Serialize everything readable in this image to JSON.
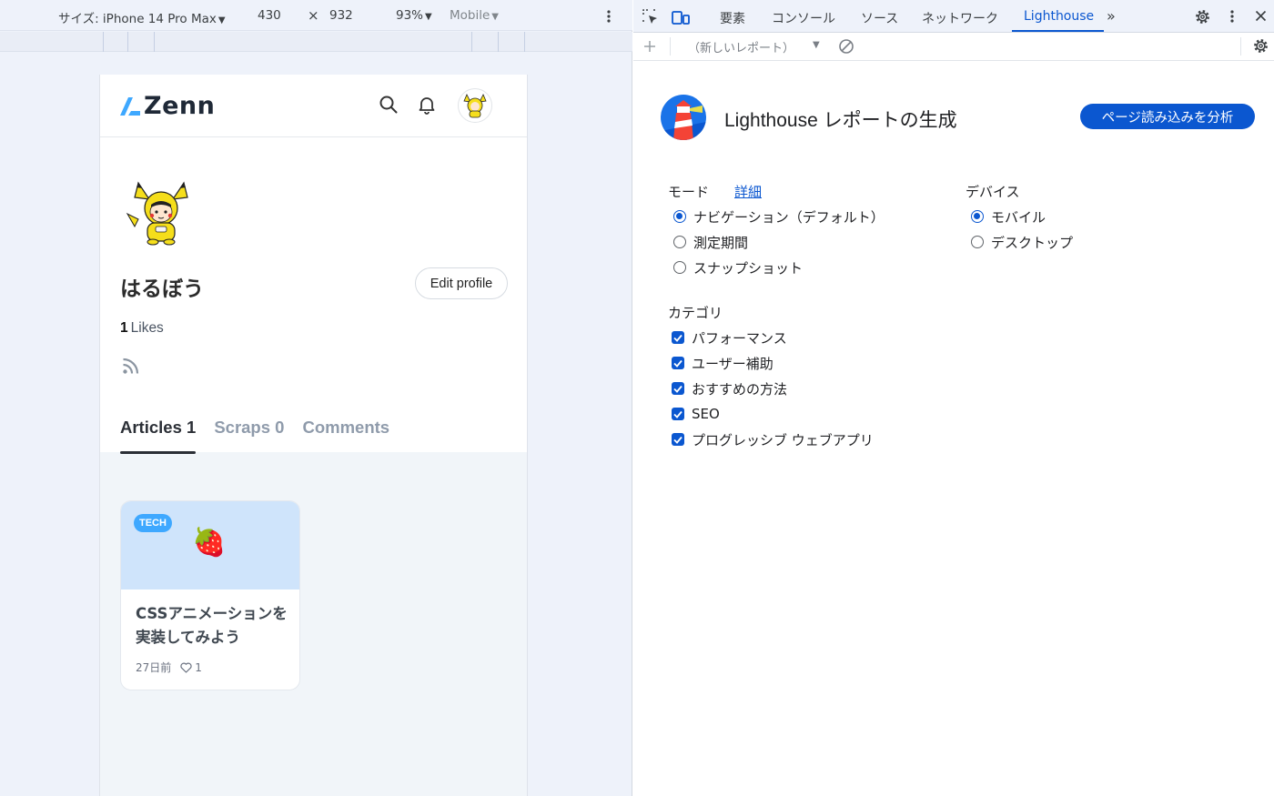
{
  "device_toolbar": {
    "size_label": "サイズ: iPhone 14 Pro Max",
    "width": "430",
    "times": "×",
    "height": "932",
    "zoom": "93%",
    "mode": "Mobile"
  },
  "zenn": {
    "logo_text": "Zenn",
    "profile_name": "はるぼう",
    "edit_profile_label": "Edit profile",
    "likes_count": "1",
    "likes_label": "Likes",
    "tabs": [
      {
        "label": "Articles",
        "count": "1"
      },
      {
        "label": "Scraps",
        "count": "0"
      },
      {
        "label": "Comments",
        "count": ""
      }
    ],
    "article_card": {
      "badge": "TECH",
      "emoji": "🍓",
      "title": "CSSアニメーションを実装してみよう",
      "date": "27日前",
      "likes": "1"
    }
  },
  "devtools": {
    "tabs": [
      "要素",
      "コンソール",
      "ソース",
      "ネットワーク",
      "Lighthouse"
    ],
    "active_tab": "Lighthouse",
    "new_report_label": "（新しいレポート）",
    "title": "Lighthouse レポートの生成",
    "analyze_button": "ページ読み込みを分析",
    "mode_label": "モード",
    "mode_detail_link": "詳細",
    "modes": [
      {
        "label": "ナビゲーション（デフォルト）",
        "selected": true
      },
      {
        "label": "測定期間",
        "selected": false
      },
      {
        "label": "スナップショット",
        "selected": false
      }
    ],
    "device_label": "デバイス",
    "devices": [
      {
        "label": "モバイル",
        "selected": true
      },
      {
        "label": "デスクトップ",
        "selected": false
      }
    ],
    "category_label": "カテゴリ",
    "categories": [
      {
        "label": "パフォーマンス",
        "checked": true
      },
      {
        "label": "ユーザー補助",
        "checked": true
      },
      {
        "label": "おすすめの方法",
        "checked": true
      },
      {
        "label": "SEO",
        "checked": true
      },
      {
        "label": "プログレッシブ ウェブアプリ",
        "checked": true
      }
    ]
  },
  "colors": {
    "accent_blue": "#0b57d0",
    "zenn_blue": "#3ea8ff",
    "card_header_bg": "#cfe4fb"
  }
}
